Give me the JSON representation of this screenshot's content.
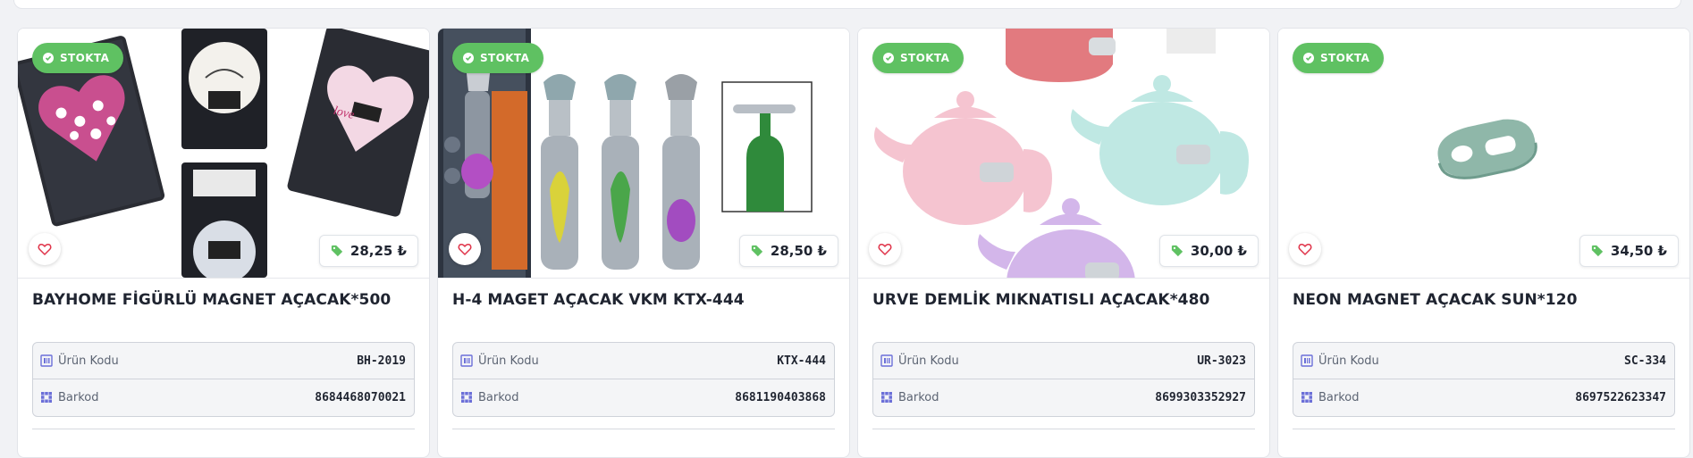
{
  "products": [
    {
      "title": "BAYHOME FİGÜRLÜ MAGNET AÇACAK*500",
      "stock_label": "STOKTA",
      "price": "28,25 ₺",
      "code_label": "Ürün Kodu",
      "code": "BH-2019",
      "barcode_label": "Barkod",
      "barcode": "8684468070021",
      "image": "heart-shaped magnet bottle openers in packaging"
    },
    {
      "title": "H-4 MAGET AÇACAK VKM KTX-444",
      "stock_label": "STOKTA",
      "price": "28,50 ₺",
      "code_label": "Ürün Kodu",
      "code": "KTX-444",
      "barcode_label": "Barkod",
      "barcode": "8681190403868",
      "image": "bottle-shaped magnet openers"
    },
    {
      "title": "URVE DEMLİK MIKNATISLI AÇACAK*480",
      "stock_label": "STOKTA",
      "price": "30,00 ₺",
      "code_label": "Ürün Kodu",
      "code": "UR-3023",
      "barcode_label": "Barkod",
      "barcode": "8699303352927",
      "image": "teapot-shaped magnet openers"
    },
    {
      "title": "NEON MAGNET AÇACAK SUN*120",
      "stock_label": "STOKTA",
      "price": "34,50 ₺",
      "code_label": "Ürün Kodu",
      "code": "SC-334",
      "barcode_label": "Barkod",
      "barcode": "8697522623347",
      "image": "small green bottle opener"
    }
  ],
  "colors": {
    "stock_badge": "#5fc162",
    "price_tag_icon": "#5fc162",
    "heart_icon": "#e0344a",
    "spec_icon": "#6b6fd8"
  }
}
